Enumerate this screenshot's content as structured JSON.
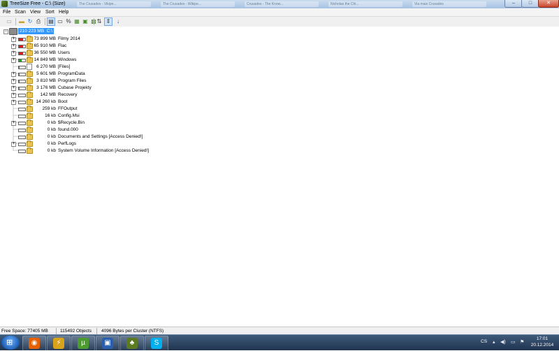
{
  "window": {
    "title": "TreeSize Free - C:\\ (Size)",
    "background_tabs": [
      "The Crusades - Vikipe...",
      "The Crusades - Wikipe...",
      "Crusades - The Know...",
      "Nicholas the Chi...",
      "Via mais Crusades"
    ]
  },
  "menu": [
    "File",
    "Scan",
    "View",
    "Sort",
    "Help"
  ],
  "toolbar": {
    "icons": [
      "drive-icon",
      "open-folder-icon",
      "refresh-icon",
      "print-icon",
      "detail-view-icon",
      "bar-view-icon",
      "percent-icon",
      "size-icon",
      "files-icon",
      "folders-icon",
      "sort-name-icon",
      "sort-size-icon",
      "sort-down-icon"
    ]
  },
  "tree": {
    "root": {
      "size": "210 223 MB",
      "name": "C:\\"
    },
    "items": [
      {
        "size": "73 899 MB",
        "name": "Filmy 2014",
        "bar": 0.35,
        "color": "#d81b1b",
        "type": "folder",
        "expandable": true
      },
      {
        "size": "65 910 MB",
        "name": "Flac",
        "bar": 0.31,
        "color": "#d81b1b",
        "type": "folder",
        "expandable": true
      },
      {
        "size": "36 550 MB",
        "name": "Users",
        "bar": 0.17,
        "color": "#d81b1b",
        "type": "folder",
        "expandable": true
      },
      {
        "size": "14 849 MB",
        "name": "Windows",
        "bar": 0.07,
        "color": "#1aa31a",
        "type": "folder",
        "expandable": true
      },
      {
        "size": "6 270 MB",
        "name": "[Files]",
        "bar": 0.03,
        "color": "#1aa31a",
        "type": "file",
        "expandable": false
      },
      {
        "size": "5 601 MB",
        "name": "ProgramData",
        "bar": 0.03,
        "color": "#1aa31a",
        "type": "folder",
        "expandable": true
      },
      {
        "size": "3 810 MB",
        "name": "Program Files",
        "bar": 0.02,
        "color": "#1aa31a",
        "type": "folder",
        "expandable": true
      },
      {
        "size": "3 176 MB",
        "name": "Cubase Projekty",
        "bar": 0.02,
        "color": "#1aa31a",
        "type": "folder",
        "expandable": true
      },
      {
        "size": "142 MB",
        "name": "Recovery",
        "bar": 0.0,
        "color": "#1aa31a",
        "type": "folder",
        "expandable": true
      },
      {
        "size": "14 260 kb",
        "name": "Boot",
        "bar": 0.0,
        "color": "#1aa31a",
        "type": "folder",
        "expandable": true
      },
      {
        "size": "259 kb",
        "name": "FFOutput",
        "bar": 0.0,
        "color": "#1aa31a",
        "type": "folder",
        "expandable": false
      },
      {
        "size": "16 kb",
        "name": "Config.Msi",
        "bar": 0.0,
        "color": "#1aa31a",
        "type": "folder",
        "expandable": false
      },
      {
        "size": "0 kb",
        "name": "$Recycle.Bin",
        "bar": 0.0,
        "color": "#1aa31a",
        "type": "folder",
        "expandable": true
      },
      {
        "size": "0 kb",
        "name": "found.000",
        "bar": 0.0,
        "color": "#1aa31a",
        "type": "folder",
        "expandable": false
      },
      {
        "size": "0 kb",
        "name": "Documents and Settings [Access Denied!]",
        "bar": 0.0,
        "color": "#1aa31a",
        "type": "folder",
        "expandable": false
      },
      {
        "size": "0 kb",
        "name": "PerfLogs",
        "bar": 0.0,
        "color": "#1aa31a",
        "type": "folder",
        "expandable": true
      },
      {
        "size": "0 kb",
        "name": "System Volume Information [Access Denied!]",
        "bar": 0.0,
        "color": "#1aa31a",
        "type": "folder",
        "expandable": false
      }
    ]
  },
  "status": {
    "free_space": "Free Space: 77405 MB",
    "objects": "115492 Objects",
    "cluster": "4096 Bytes per Cluster (NTFS)"
  },
  "taskbar": {
    "apps": [
      {
        "icon": "firefox-icon",
        "color": "#e66000"
      },
      {
        "icon": "winamp-icon",
        "color": "#d9a21b"
      },
      {
        "icon": "utorrent-icon",
        "color": "#4b9b2f"
      },
      {
        "icon": "save-icon",
        "color": "#2a5fb0"
      },
      {
        "icon": "treesize-icon",
        "color": "#5b7a22"
      },
      {
        "icon": "skype-icon",
        "color": "#00aff0"
      }
    ],
    "language": "CS",
    "time": "17:01",
    "date": "20.12.2014"
  }
}
